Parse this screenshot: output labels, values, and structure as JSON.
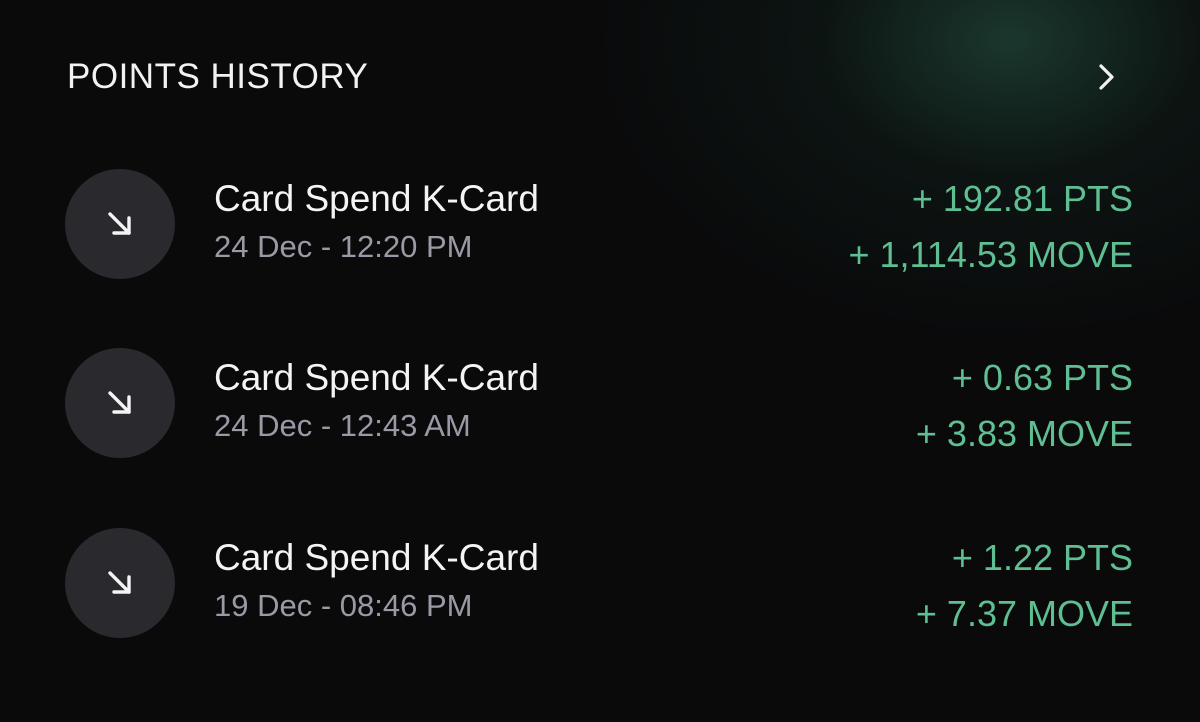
{
  "colors": {
    "background": "#0a0a0b",
    "accent_green": "#5fbf92",
    "icon_circle": "#2a2a2e",
    "title_text": "#f2f2f4",
    "secondary_text": "#9a9aa6"
  },
  "header": {
    "title": "POINTS HISTORY",
    "chevron_icon": "chevron-right-icon"
  },
  "transactions": [
    {
      "icon": "arrow-down-right-icon",
      "title": "Card Spend K-Card",
      "date": "24 Dec - 12:20 PM",
      "points": "+ 192.81 PTS",
      "move": "+ 1,114.53 MOVE"
    },
    {
      "icon": "arrow-down-right-icon",
      "title": "Card Spend K-Card",
      "date": "24 Dec - 12:43 AM",
      "points": "+ 0.63 PTS",
      "move": "+ 3.83 MOVE"
    },
    {
      "icon": "arrow-down-right-icon",
      "title": "Card Spend K-Card",
      "date": "19 Dec - 08:46 PM",
      "points": "+ 1.22 PTS",
      "move": "+ 7.37 MOVE"
    }
  ]
}
